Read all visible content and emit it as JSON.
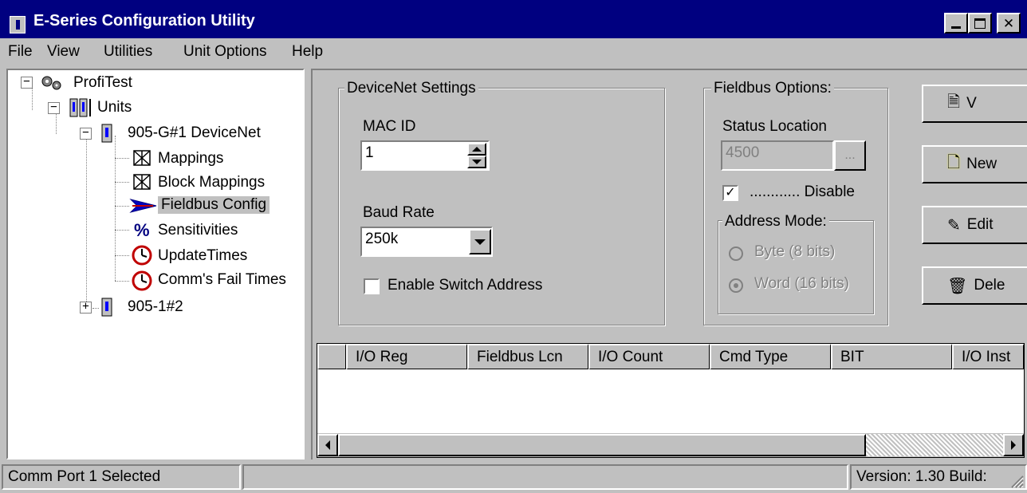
{
  "window": {
    "title": "E-Series Configuration Utility",
    "titlebar_color": "#000080",
    "caption_buttons": [
      "minimize-icon",
      "maximize-icon",
      "close-icon"
    ]
  },
  "menu": {
    "items": [
      "File",
      "View",
      "Utilities",
      "Unit Options",
      "Help"
    ]
  },
  "tree": {
    "root": "ProfiTest",
    "units": "Units",
    "unit1": "905-G#1 DeviceNet",
    "children": [
      {
        "label": "Mappings",
        "icon": "mapping-icon"
      },
      {
        "label": "Block Mappings",
        "icon": "block-mapping-icon"
      },
      {
        "label": "Fieldbus Config",
        "icon": "fieldbus-arrow-icon",
        "selected": true
      },
      {
        "label": "Sensitivities",
        "icon": "percent-icon"
      },
      {
        "label": "UpdateTimes",
        "icon": "clock-icon"
      },
      {
        "label": "Comm's Fail Times",
        "icon": "clock-icon"
      }
    ],
    "unit2": "905-1#2"
  },
  "devicenet": {
    "group_label": "DeviceNet Settings",
    "mac_id_label": "MAC ID",
    "mac_id_value": "1",
    "baud_rate_label": "Baud Rate",
    "baud_rate_value": "250k",
    "enable_switch_label": "Enable Switch Address",
    "enable_switch_checked": false
  },
  "fieldbus": {
    "group_label": "Fieldbus Options:",
    "status_location_label": "Status Location",
    "status_location_value": "4500",
    "browse_label": "...",
    "disable_label": "............ Disable",
    "disable_checked": true,
    "address_mode_label": "Address Mode:",
    "byte_label": "Byte (8 bits)",
    "word_label": "Word (16 bits)",
    "selected_mode": "Word (16 bits)"
  },
  "side_buttons": [
    {
      "label": "V",
      "icon": "view-doc-icon"
    },
    {
      "label": "New",
      "icon": "new-doc-icon"
    },
    {
      "label": "Edit",
      "icon": "edit-icon"
    },
    {
      "label": "Dele",
      "icon": "trash-icon"
    }
  ],
  "grid": {
    "columns": [
      "",
      "I/O Reg",
      "Fieldbus Lcn",
      "I/O Count",
      "Cmd Type",
      "BIT",
      "I/O Inst"
    ],
    "rows": []
  },
  "status": {
    "left": "Comm Port 1 Selected",
    "middle": "",
    "version": "Version: 1.30 Build:"
  }
}
